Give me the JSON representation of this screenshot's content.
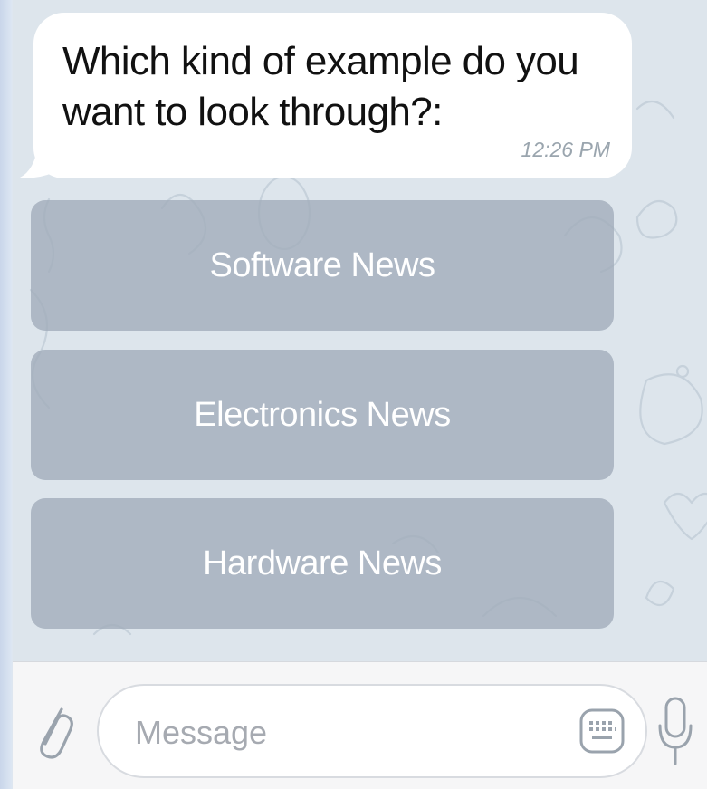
{
  "message": {
    "text": "Which kind of example do you want to look through?:",
    "time": "12:26 PM"
  },
  "keyboard": {
    "buttons": [
      {
        "label": "Software News"
      },
      {
        "label": "Electronics News"
      },
      {
        "label": "Hardware News"
      }
    ]
  },
  "input_bar": {
    "placeholder": "Message",
    "icons": {
      "attach": "paperclip-icon",
      "keyboard": "keyboard-icon",
      "voice": "microphone-icon"
    }
  },
  "colors": {
    "wallpaper": "#dde5ec",
    "bubble": "#ffffff",
    "keyboard_button": "#a0acba",
    "input_bar": "#f6f6f7",
    "icon": "#9aa3ad"
  }
}
